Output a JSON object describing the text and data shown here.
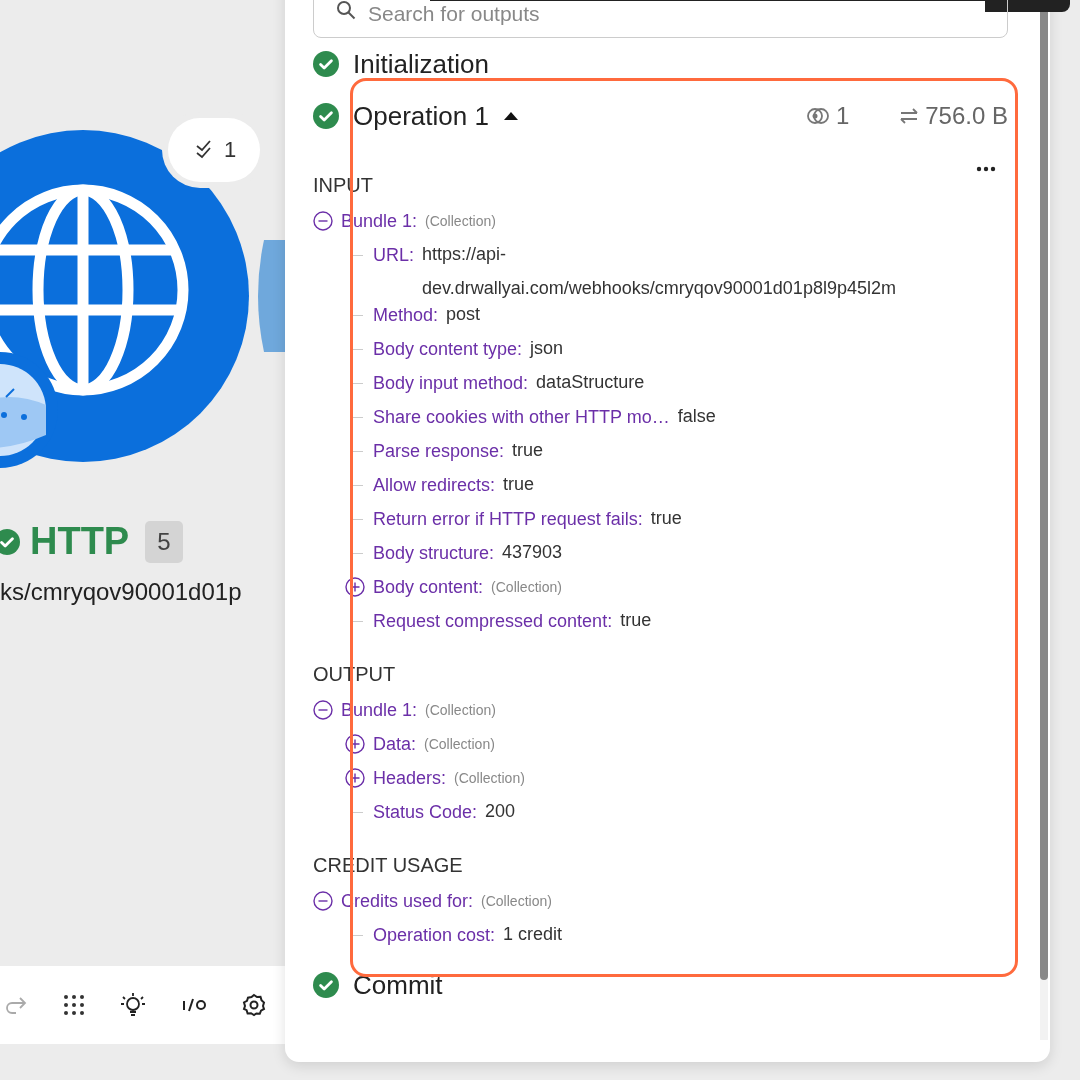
{
  "module": {
    "name": "HTTP",
    "done": true,
    "count": "5",
    "subtitle": "ks/cmryqov90001d01p",
    "badge": "1"
  },
  "toolbar": [
    {
      "kind": "redo"
    },
    {
      "kind": "grid"
    },
    {
      "kind": "bulb"
    },
    {
      "kind": "io"
    },
    {
      "kind": "gear"
    }
  ],
  "search": {
    "placeholder": "Search for outputs"
  },
  "steps": [
    {
      "label": "Initialization",
      "done": true
    },
    {
      "label": "Operation 1",
      "done": true,
      "expanded": true,
      "highlighted": true,
      "views": "1",
      "size": "756.0 B",
      "sections": [
        {
          "title": "INPUT",
          "items": [
            {
              "label": "Bundle 1:",
              "type": "(Collection)",
              "expanded": true,
              "children": [
                {
                  "label": "URL:",
                  "value": "https://api-dev.drwallyai.com/webhooks/cmryqov90001d01p8l9p45l2m"
                },
                {
                  "label": "Method:",
                  "value": "post"
                },
                {
                  "label": "Body content type:",
                  "value": "json"
                },
                {
                  "label": "Body input method:",
                  "value": "dataStructure"
                },
                {
                  "label": "Share cookies with other HTTP mo…",
                  "value": "false"
                },
                {
                  "label": "Parse response:",
                  "value": "true"
                },
                {
                  "label": "Allow redirects:",
                  "value": "true"
                },
                {
                  "label": "Return error if HTTP request fails:",
                  "value": "true"
                },
                {
                  "label": "Body structure:",
                  "value": "437903"
                },
                {
                  "label": "Body content:",
                  "type": "(Collection)",
                  "expanded": false
                },
                {
                  "label": "Request compressed content:",
                  "value": "true"
                }
              ]
            }
          ]
        },
        {
          "title": "OUTPUT",
          "items": [
            {
              "label": "Bundle 1:",
              "type": "(Collection)",
              "expanded": true,
              "children": [
                {
                  "label": "Data:",
                  "type": "(Collection)",
                  "expanded": false
                },
                {
                  "label": "Headers:",
                  "type": "(Collection)",
                  "expanded": false
                },
                {
                  "label": "Status Code:",
                  "value": "200"
                }
              ]
            }
          ]
        },
        {
          "title": "CREDIT USAGE",
          "items": [
            {
              "label": "Credits used for:",
              "type": "(Collection)",
              "expanded": true,
              "children": [
                {
                  "label": "Operation cost:",
                  "value": "1 credit"
                }
              ]
            }
          ]
        }
      ]
    },
    {
      "label": "Commit",
      "done": true
    }
  ]
}
